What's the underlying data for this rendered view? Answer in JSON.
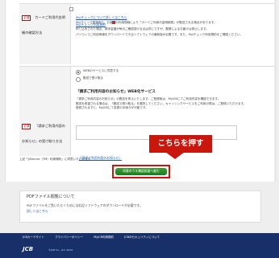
{
  "required_badge": "必須",
  "row1": {
    "label": "カードご利用代金明細の確認方法",
    "link1": "MyJチェックについて詳しくはこちら",
    "link2": "MyJチェック利用規約",
    "notes": [
      "MyJチェック登録後も、お客様の利用明細により「カードご利用代金明細書」が郵送される場合があります。",
      "申し込みされた場合、請求金額が毎月ご確認頂ける点は同じですが、郵便によるお届けは停止します。",
      "パソコンでご利用明細をダウンロードできるソフトウェアの最新版が必要です。また、MyJチェック利用規約をご確認ください。"
    ]
  },
  "row2": {
    "label": "「請求ご利用内容のお知らせ」の受け取り方法",
    "options": [
      "WEBのサービスに同意する",
      "郵送で受け取る"
    ],
    "section_title": "「請求ご利用内容のお知らせ」WEB化サービス",
    "body": [
      "「請求ご利用内容のお知らせ」の郵送を停止いたします。ご登録後は、MyJCBにてご利用内容を確認できます。",
      "郵送を希望される場合は、「郵送で受け取る」を選択してください。キャッシングサービスをご利用の際は、ご登録いただけます。",
      "登録されますと、MyJCBにて変更の手続きが可能です。"
    ],
    "note_link": "「請求ご利用内容のお知らせ」"
  },
  "agreement": "上記「J/Secure（TM）利用規約」に同意いただける方",
  "callout": "こちらを押す",
  "submit": "同意のうえ確認画面へ進む",
  "pdf": {
    "title": "PDFファイル閲覧について",
    "desc": "PDFファイルをご覧いただくためには右記ソフトウェアのダウンロードが必要です。",
    "link": "詳しくはこちら"
  },
  "footer": {
    "links": [
      "JCBカードサイト",
      "プライバシーポリシー",
      "MyJCB利用規約",
      "JCBのセキュリティについて"
    ],
    "logo": "JCB",
    "copyright": "©JCB Co., Ltd. 2024"
  },
  "colors": {
    "accent_red": "#c9170d",
    "button_green": "#2a8f2a",
    "footer_navy": "#17306a",
    "link_blue": "#1a57b8"
  }
}
